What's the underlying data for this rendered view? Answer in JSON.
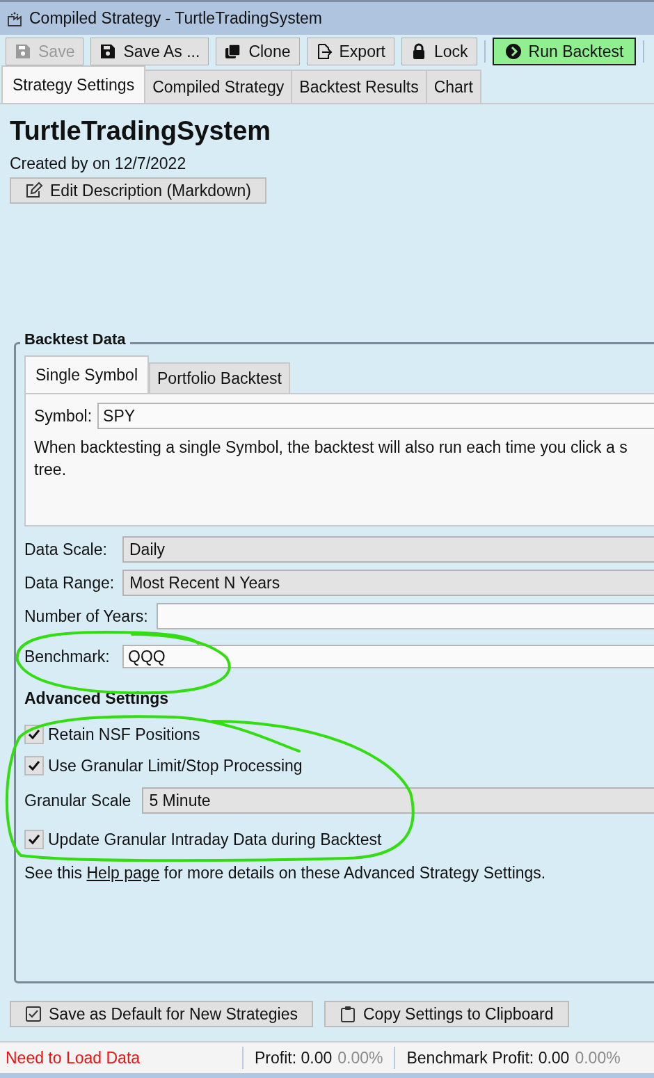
{
  "window": {
    "title": "Compiled Strategy - TurtleTradingSystem"
  },
  "toolbar": [
    {
      "label": "Save",
      "disabled": true,
      "highlighted": false
    },
    {
      "label": "Save As ...",
      "disabled": false,
      "highlighted": false
    },
    {
      "label": "Clone",
      "disabled": false,
      "highlighted": false
    },
    {
      "label": "Export",
      "disabled": false,
      "highlighted": false
    },
    {
      "label": "Lock",
      "disabled": false,
      "highlighted": false
    },
    {
      "label": "Run Backtest",
      "disabled": false,
      "highlighted": true
    }
  ],
  "tabs": [
    {
      "label": "Strategy Settings",
      "selected": true
    },
    {
      "label": "Compiled Strategy",
      "selected": false
    },
    {
      "label": "Backtest Results",
      "selected": false
    },
    {
      "label": "Chart",
      "selected": false
    }
  ],
  "strategy": {
    "name": "TurtleTradingSystem",
    "created": "Created by  on 12/7/2022",
    "edit_button": "Edit Description (Markdown)"
  },
  "backtest_data": {
    "title": "Backtest Data",
    "tabs": [
      {
        "label": "Single Symbol",
        "selected": true
      },
      {
        "label": "Portfolio Backtest",
        "selected": false
      }
    ],
    "symbol": {
      "label": "Symbol:",
      "value": "SPY"
    },
    "note_lines": [
      "When backtesting a single Symbol, the backtest will also run each time you click a s",
      "tree."
    ],
    "fields": [
      {
        "label": "Data Scale:",
        "kind": "combo",
        "value": "Daily"
      },
      {
        "label": "Data Range:",
        "kind": "combo",
        "value": "Most Recent N Years"
      },
      {
        "label": "Number of Years:",
        "kind": "text"
      },
      {
        "label": "Benchmark:",
        "kind": "text",
        "value": "QQQ"
      }
    ],
    "advanced_title": "Advanced Settings",
    "advanced": [
      {
        "kind": "checkbox",
        "label": "Retain NSF Positions",
        "checked": true
      },
      {
        "kind": "checkbox",
        "label": "Use Granular Limit/Stop Processing",
        "checked": true
      },
      {
        "kind": "combo",
        "label": "Granular Scale",
        "value": "5 Minute"
      },
      {
        "kind": "checkbox",
        "label": "Update Granular Intraday Data during Backtest",
        "checked": true
      }
    ],
    "help": {
      "before": "See this",
      "link": "Help page",
      "after": "for more details on these Advanced Strategy Settings."
    }
  },
  "bottom_buttons": [
    {
      "label": "Save as Default for New Strategies"
    },
    {
      "label": "Copy Settings to Clipboard"
    }
  ],
  "status_bar": {
    "message": "Need to Load Data",
    "profit": "Profit: 0.00",
    "profit_pct": "0.00%",
    "benchmark": "Benchmark Profit: 0.00",
    "benchmark_pct": "0.00%"
  },
  "ink_marks": [
    {
      "kind": "loop"
    },
    {
      "kind": "loop"
    }
  ]
}
